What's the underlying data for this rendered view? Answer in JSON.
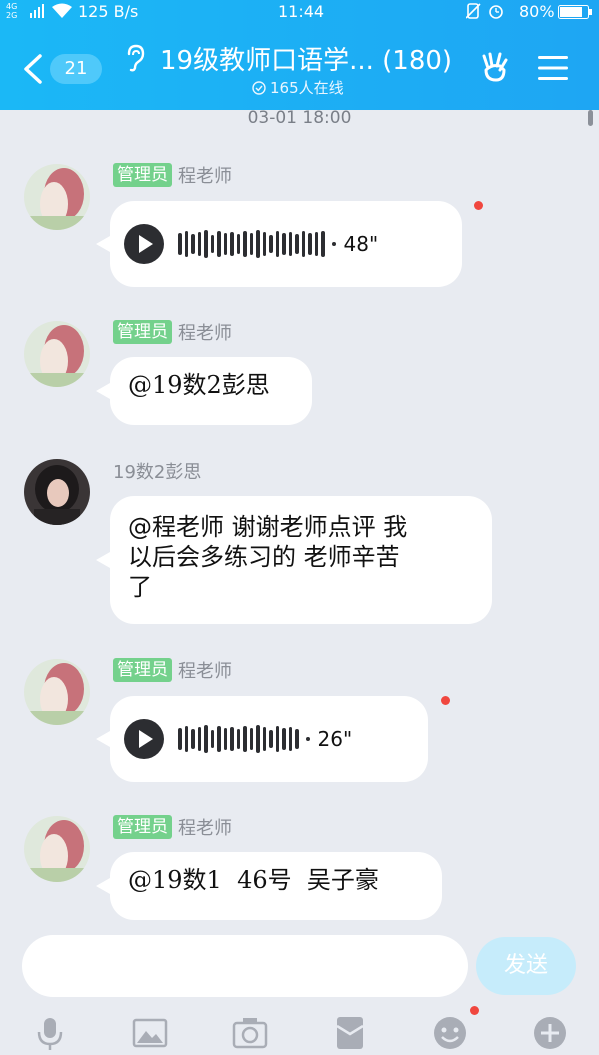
{
  "status_bar": {
    "network": "4G\n2G",
    "speed": "125 B/s",
    "time": "11:44",
    "battery": "80%"
  },
  "header": {
    "unread_count": "21",
    "title": "19级教师口语学...  (180)",
    "online": "165人在线"
  },
  "chat": {
    "timestamp": "03-01 18:00",
    "messages": [
      {
        "role_badge": "管理员",
        "sender": "程老师",
        "type": "voice",
        "duration": "48\""
      },
      {
        "role_badge": "管理员",
        "sender": "程老师",
        "type": "text",
        "text": "@19数2彭思"
      },
      {
        "sender": "19数2彭思",
        "type": "text",
        "lines": [
          "@程老师 谢谢老师点评 我",
          "以后会多练习的 老师辛苦",
          "了"
        ]
      },
      {
        "role_badge": "管理员",
        "sender": "程老师",
        "type": "voice",
        "duration": "26\""
      },
      {
        "role_badge": "管理员",
        "sender": "程老师",
        "type": "text",
        "text": "@19数1  46号  吴子豪"
      }
    ]
  },
  "composer": {
    "input_value": "",
    "send_label": "发送",
    "tools": [
      "microphone-icon",
      "image-icon",
      "camera-icon",
      "red-packet-icon",
      "emoji-icon",
      "plus-icon"
    ]
  },
  "colors": {
    "header": "#1ea6f3",
    "badge": "#74d18c",
    "unread_dot": "#f0473f",
    "send_disabled": "#c6ecfb"
  }
}
